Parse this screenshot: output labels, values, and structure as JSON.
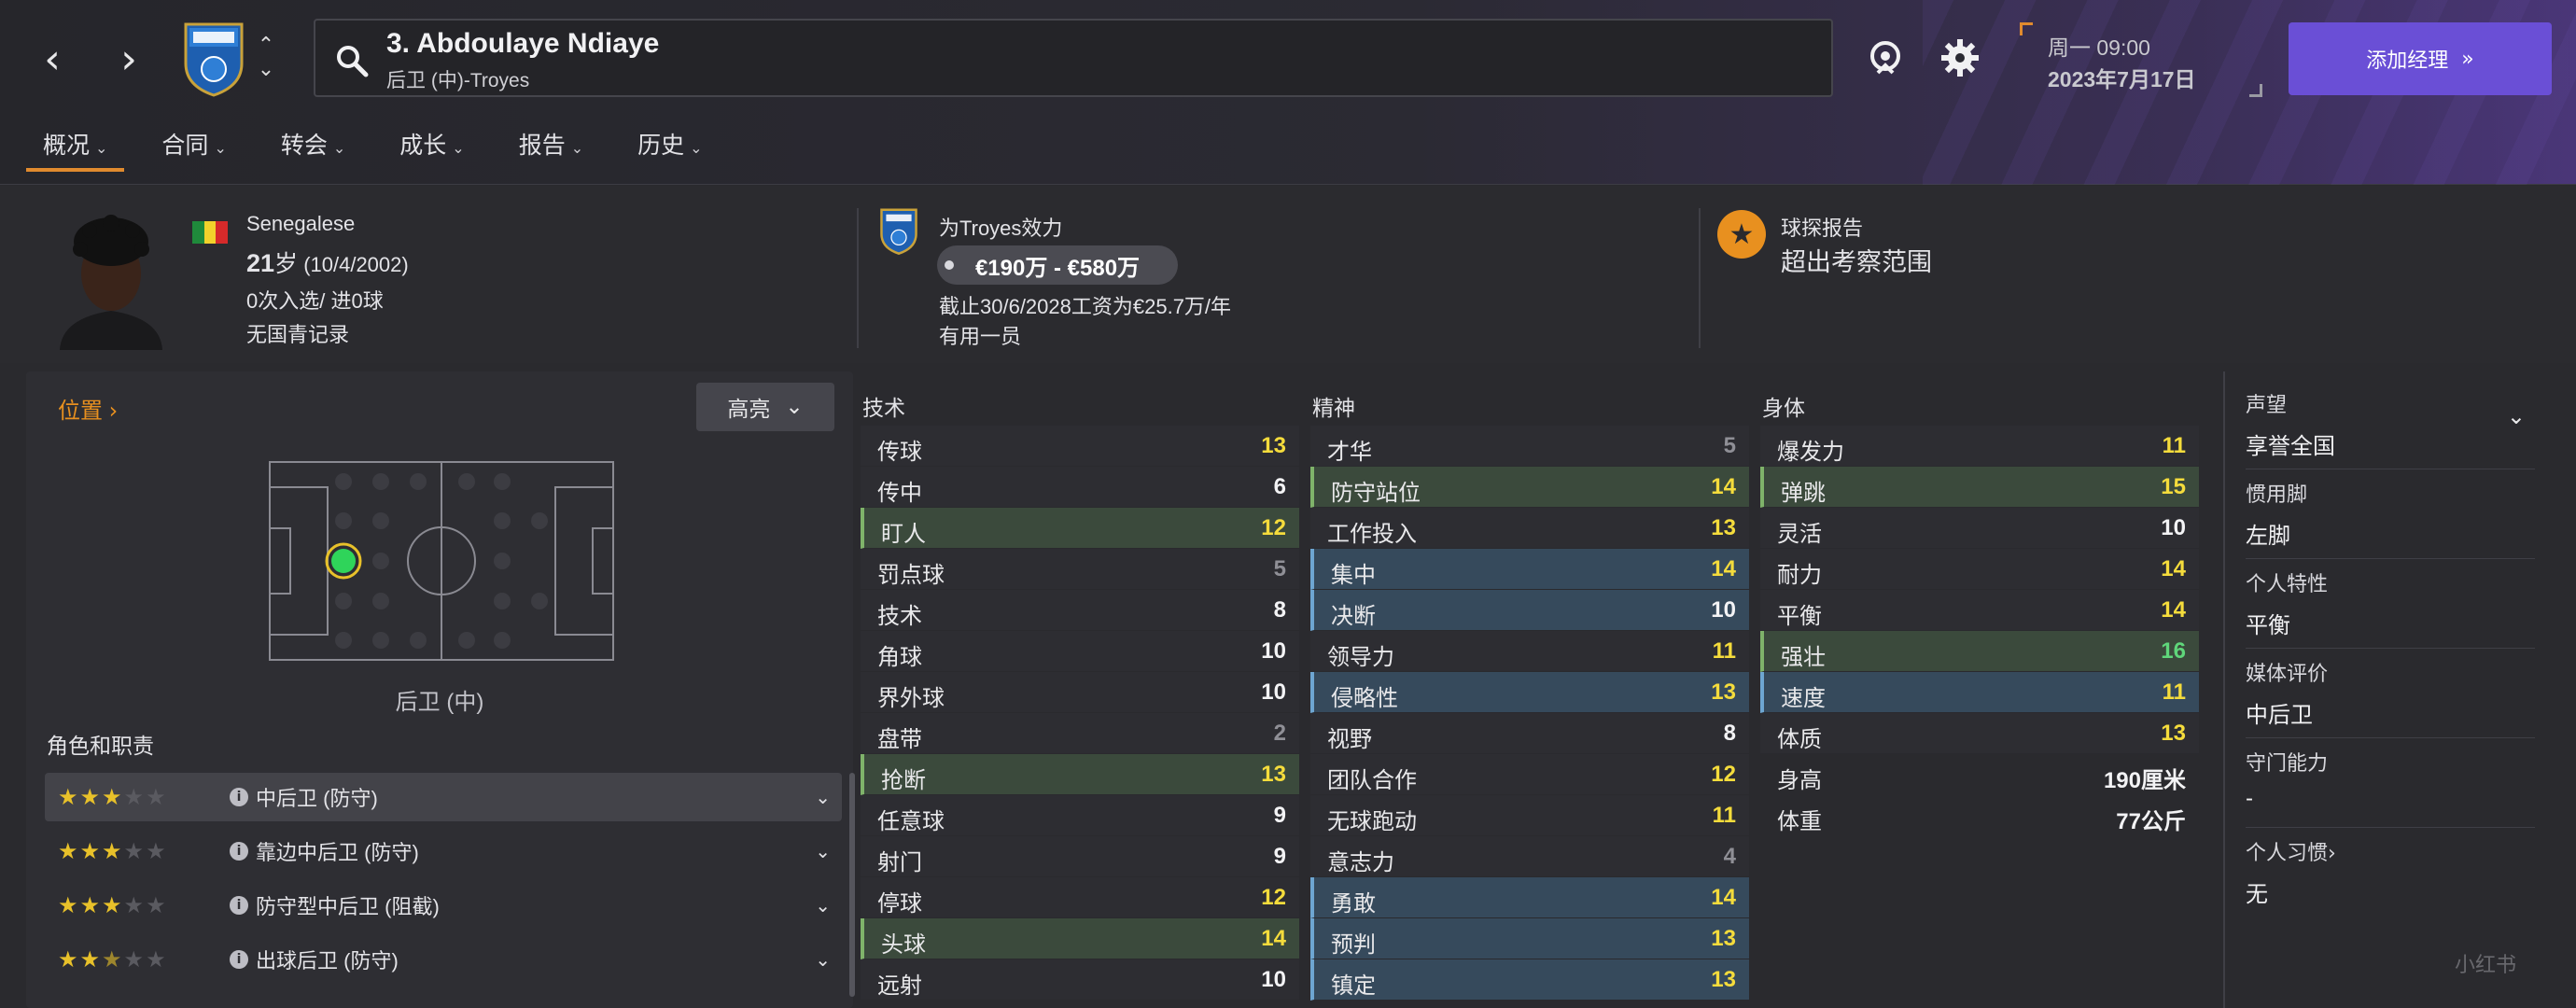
{
  "header": {
    "player_title": "3. Abdoulaye Ndiaye",
    "player_sub": "后卫 (中)-Troyes",
    "date_day": "周一 09:00",
    "date_full": "2023年7月17日",
    "add_manager": "添加经理",
    "accent": "#6a4fd6"
  },
  "tabs": [
    {
      "label": "概况"
    },
    {
      "label": "合同"
    },
    {
      "label": "转会"
    },
    {
      "label": "成长"
    },
    {
      "label": "报告"
    },
    {
      "label": "历史"
    }
  ],
  "info": {
    "nationality": "Senegalese",
    "age_num": "21",
    "age_suffix": "岁",
    "dob": "(10/4/2002)",
    "caps": "0次入选/ 进0球",
    "youth": "无国青记录",
    "plays_for": "为Troyes效力",
    "wage_range": "€190万 - €580万",
    "contract": "截止30/6/2028工资为€25.7万/年",
    "squad_status": "有用一员",
    "scout_title": "球探报告",
    "scout_value": "超出考察范围"
  },
  "left": {
    "position_link": "位置",
    "highlight_btn": "高亮",
    "pitch_label": "后卫 (中)",
    "roles_title": "角色和职责",
    "roles": [
      {
        "stars": "★★★☆☆",
        "label": "中后卫 (防守)",
        "rating": 3
      },
      {
        "stars": "★★★☆☆",
        "label": "靠边中后卫 (防守)",
        "rating": 3
      },
      {
        "stars": "★★★☆☆",
        "label": "防守型中后卫 (阻截)",
        "rating": 3
      },
      {
        "stars": "★★½☆☆",
        "label": "出球后卫 (防守)",
        "rating": 2.5
      }
    ]
  },
  "technical": {
    "title": "技术",
    "rows": [
      {
        "name": "传球",
        "value": "13"
      },
      {
        "name": "传中",
        "value": "6"
      },
      {
        "name": "盯人",
        "value": "12"
      },
      {
        "name": "罚点球",
        "value": "5"
      },
      {
        "name": "技术",
        "value": "8"
      },
      {
        "name": "角球",
        "value": "10"
      },
      {
        "name": "界外球",
        "value": "10"
      },
      {
        "name": "盘带",
        "value": "2"
      },
      {
        "name": "抢断",
        "value": "13"
      },
      {
        "name": "任意球",
        "value": "9"
      },
      {
        "name": "射门",
        "value": "9"
      },
      {
        "name": "停球",
        "value": "12"
      },
      {
        "name": "头球",
        "value": "14"
      },
      {
        "name": "远射",
        "value": "10"
      }
    ]
  },
  "mental": {
    "title": "精神",
    "rows": [
      {
        "name": "才华",
        "value": "5"
      },
      {
        "name": "防守站位",
        "value": "14"
      },
      {
        "name": "工作投入",
        "value": "13"
      },
      {
        "name": "集中",
        "value": "14"
      },
      {
        "name": "决断",
        "value": "10"
      },
      {
        "name": "领导力",
        "value": "11"
      },
      {
        "name": "侵略性",
        "value": "13"
      },
      {
        "name": "视野",
        "value": "8"
      },
      {
        "name": "团队合作",
        "value": "12"
      },
      {
        "name": "无球跑动",
        "value": "11"
      },
      {
        "name": "意志力",
        "value": "4"
      },
      {
        "name": "勇敢",
        "value": "14"
      },
      {
        "name": "预判",
        "value": "13"
      },
      {
        "name": "镇定",
        "value": "13"
      }
    ]
  },
  "physical": {
    "title": "身体",
    "rows": [
      {
        "name": "爆发力",
        "value": "11"
      },
      {
        "name": "弹跳",
        "value": "15"
      },
      {
        "name": "灵活",
        "value": "10"
      },
      {
        "name": "耐力",
        "value": "14"
      },
      {
        "name": "平衡",
        "value": "14"
      },
      {
        "name": "强壮",
        "value": "16"
      },
      {
        "name": "速度",
        "value": "11"
      },
      {
        "name": "体质",
        "value": "13"
      }
    ],
    "height_label": "身高",
    "height_value": "190厘米",
    "weight_label": "体重",
    "weight_value": "77公斤"
  },
  "right": {
    "reputation_label": "声望",
    "reputation_value": "享誉全国",
    "foot_label": "惯用脚",
    "foot_value": "左脚",
    "trait_label": "个人特性",
    "trait_value": "平衡",
    "media_label": "媒体评价",
    "media_value": "中后卫",
    "gk_label": "守门能力",
    "gk_value": "-",
    "habits_label": "个人习惯",
    "habits_value": "无"
  },
  "watermark": "小红书"
}
